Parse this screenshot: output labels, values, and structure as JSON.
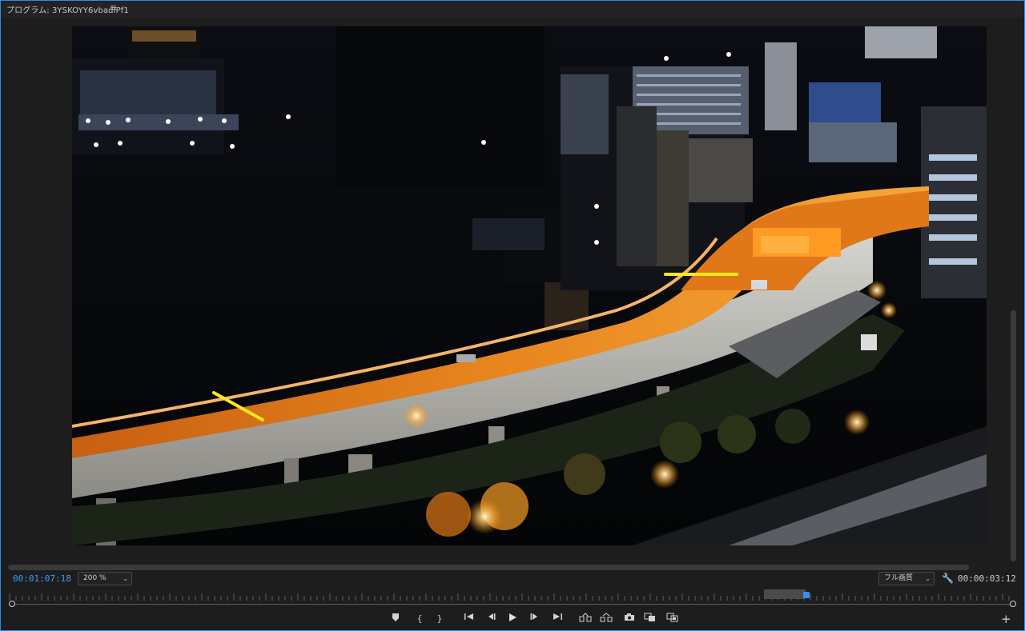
{
  "panel": {
    "title": "プログラム: 3YSKOYY6vbadIPf1",
    "menu_icon": "hamburger-icon"
  },
  "player": {
    "current_timecode": "00:01:07:18",
    "zoom": "200 %",
    "quality": "フル画質",
    "duration_timecode": "00:00:03:12",
    "playhead_fraction": 0.8
  },
  "colors": {
    "accent": "#2d8ceb",
    "timecode_blue": "#3f9bff",
    "annotation_yellow": "#ffe81a",
    "highway_orange": "#e8861e"
  },
  "transport": [
    {
      "name": "add-marker-icon",
      "glyph": "⬥"
    },
    {
      "name": "mark-in-icon",
      "glyph": "{"
    },
    {
      "name": "mark-out-icon",
      "glyph": "}"
    },
    {
      "name": "go-to-in-icon",
      "glyph": "⇤"
    },
    {
      "name": "step-back-icon",
      "glyph": "◂|"
    },
    {
      "name": "play-icon",
      "glyph": "▶"
    },
    {
      "name": "step-forward-icon",
      "glyph": "|▸"
    },
    {
      "name": "go-to-out-icon",
      "glyph": "⇥"
    },
    {
      "name": "lift-icon",
      "glyph": "lift"
    },
    {
      "name": "extract-icon",
      "glyph": "extract"
    },
    {
      "name": "export-frame-icon",
      "glyph": "camera"
    },
    {
      "name": "insert-icon",
      "glyph": "insert"
    },
    {
      "name": "overwrite-icon",
      "glyph": "overwrite"
    }
  ]
}
